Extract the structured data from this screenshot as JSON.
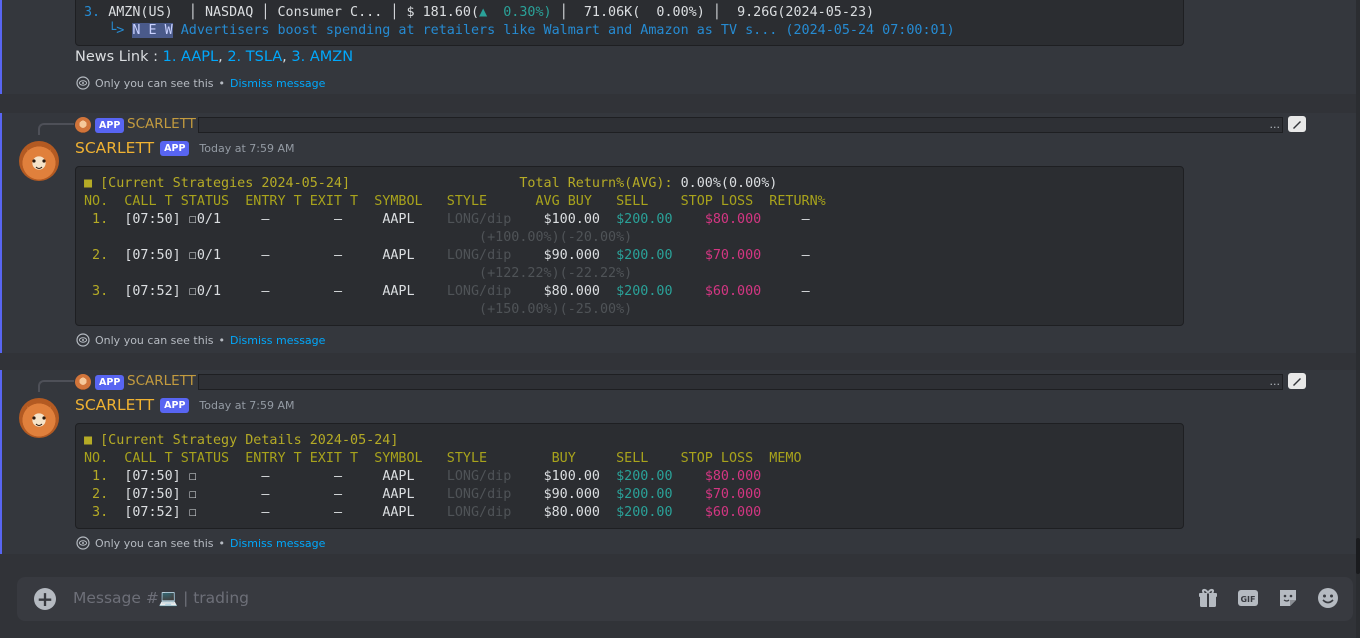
{
  "msg1": {
    "amzn_row": {
      "num": "3.",
      "symbol": "AMZN(US)",
      "exchange": "NASDAQ",
      "sector": "Consumer C...",
      "price": "$ 181.60(",
      "arrow": "▲",
      "change": "  0.30%)",
      "volume": "71.06K(  0.00%)",
      "cap": "9.26G(2024-05-23)"
    },
    "news": {
      "prefix": "└> ",
      "badge": "N E W",
      "text": " Advertisers boost spending at retailers like Walmart and Amazon as TV s... (2024-05-24 07:00:01)"
    },
    "news_link": {
      "label": "News Link : ",
      "links": [
        "1. AAPL",
        "2. TSLA",
        "3. AMZN"
      ],
      "sep": ", "
    },
    "only_you": "Only you can see this",
    "dismiss": "Dismiss message"
  },
  "msg2": {
    "reply_name": "SCARLETT",
    "reply_badge": "APP",
    "reply_more": "...",
    "author": "SCARLETT",
    "badge": "APP",
    "time": "Today at 7:59 AM",
    "title": "■ [Current Strategies 2024-05-24]",
    "total_label": "Total Return%(AVG):",
    "total_value": " 0.00%(0.00%)",
    "header": "NO.  CALL T STATUS  ENTRY T EXIT T  SYMBOL   STYLE      AVG BUY   SELL    STOP LOSS  RETURN%",
    "rows": [
      {
        "no": " 1.",
        "call": "[07:50]",
        "status": "0/1",
        "entry": "–",
        "exit": "–",
        "symbol": "AAPL",
        "style": "LONG/dip",
        "buy": "$100.00",
        "sell": "$200.00",
        "stop": "$80.000",
        "ret": "–",
        "pct": "(+100.00%)(-20.00%)"
      },
      {
        "no": " 2.",
        "call": "[07:50]",
        "status": "0/1",
        "entry": "–",
        "exit": "–",
        "symbol": "AAPL",
        "style": "LONG/dip",
        "buy": "$90.000",
        "sell": "$200.00",
        "stop": "$70.000",
        "ret": "–",
        "pct": "(+122.22%)(-22.22%)"
      },
      {
        "no": " 3.",
        "call": "[07:52]",
        "status": "0/1",
        "entry": "–",
        "exit": "–",
        "symbol": "AAPL",
        "style": "LONG/dip",
        "buy": "$80.000",
        "sell": "$200.00",
        "stop": "$60.000",
        "ret": "–",
        "pct": "(+150.00%)(-25.00%)"
      }
    ],
    "only_you": "Only you can see this",
    "dismiss": "Dismiss message"
  },
  "msg3": {
    "reply_name": "SCARLETT",
    "reply_badge": "APP",
    "reply_more": "...",
    "author": "SCARLETT",
    "badge": "APP",
    "time": "Today at 7:59 AM",
    "title": "■ [Current Strategy Details 2024-05-24]",
    "header": "NO.  CALL T STATUS  ENTRY T EXIT T  SYMBOL   STYLE        BUY     SELL    STOP LOSS  MEMO",
    "rows": [
      {
        "no": " 1.",
        "call": "[07:50]",
        "entry": "–",
        "exit": "–",
        "symbol": "AAPL",
        "style": "LONG/dip",
        "buy": "$100.00",
        "sell": "$200.00",
        "stop": "$80.000"
      },
      {
        "no": " 2.",
        "call": "[07:50]",
        "entry": "–",
        "exit": "–",
        "symbol": "AAPL",
        "style": "LONG/dip",
        "buy": "$90.000",
        "sell": "$200.00",
        "stop": "$70.000"
      },
      {
        "no": " 3.",
        "call": "[07:52]",
        "entry": "–",
        "exit": "–",
        "symbol": "AAPL",
        "style": "LONG/dip",
        "buy": "$80.000",
        "sell": "$200.00",
        "stop": "$60.000"
      }
    ],
    "only_you": "Only you can see this",
    "dismiss": "Dismiss message"
  },
  "composer": {
    "placeholder": "Message #💻 | trading",
    "icons": [
      "gift-icon",
      "gif-icon",
      "sticker-icon",
      "emoji-icon"
    ],
    "gif_label": "GIF"
  }
}
